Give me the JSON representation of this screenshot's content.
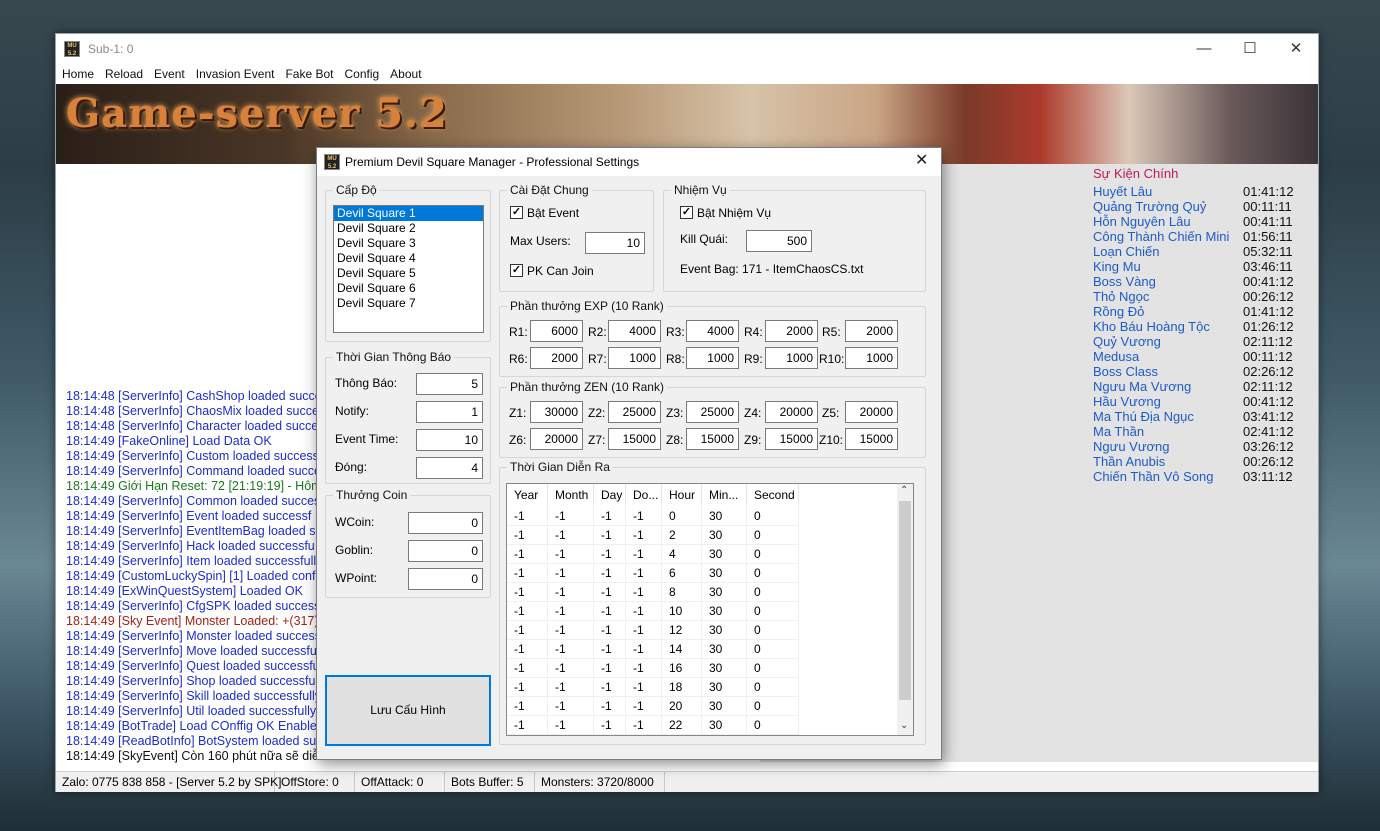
{
  "main": {
    "title": "Sub-1: 0",
    "icon": "mu-52-icon",
    "banner": "Game-server 5.2",
    "menu": [
      "Home",
      "Reload",
      "Event",
      "Invasion Event",
      "Fake Bot",
      "Config",
      "About"
    ]
  },
  "log": [
    {
      "t": "18:14:48 [ServerInfo] CashShop loaded succes",
      "c": "blue"
    },
    {
      "t": "18:14:48 [ServerInfo] ChaosMix loaded succe",
      "c": "blue"
    },
    {
      "t": "18:14:48 [ServerInfo] Character loaded succe",
      "c": "blue"
    },
    {
      "t": "18:14:49 [FakeOnline] Load Data OK",
      "c": "blue"
    },
    {
      "t": "18:14:49 [ServerInfo] Custom loaded success",
      "c": "blue"
    },
    {
      "t": "18:14:49 [ServerInfo] Command loaded succe",
      "c": "blue"
    },
    {
      "t": "18:14:49 Giới Hạn Reset: 72 [21:19:19] - Hôm",
      "c": "green"
    },
    {
      "t": "18:14:49 [ServerInfo] Common loaded succes",
      "c": "blue"
    },
    {
      "t": "18:14:49 [ServerInfo] Event loaded successf",
      "c": "blue"
    },
    {
      "t": "18:14:49 [ServerInfo] EventItemBag loaded s",
      "c": "blue"
    },
    {
      "t": "18:14:49 [ServerInfo] Hack loaded successfu",
      "c": "blue"
    },
    {
      "t": "18:14:49 [ServerInfo] Item loaded successfull",
      "c": "blue"
    },
    {
      "t": "18:14:49 [CustomLuckySpin] [1] Loaded conf",
      "c": "blue"
    },
    {
      "t": "18:14:49 [ExWinQuestSystem] Loaded OK",
      "c": "blue"
    },
    {
      "t": "18:14:49 [ServerInfo] CfgSPK loaded success",
      "c": "blue"
    },
    {
      "t": "18:14:49 [Sky Event] Monster Loaded: +(317)",
      "c": "red"
    },
    {
      "t": "18:14:49 [ServerInfo] Monster loaded success",
      "c": "blue"
    },
    {
      "t": "18:14:49 [ServerInfo] Move loaded successfu",
      "c": "blue"
    },
    {
      "t": "18:14:49 [ServerInfo] Quest loaded successfu",
      "c": "blue"
    },
    {
      "t": "18:14:49 [ServerInfo] Shop loaded successfu",
      "c": "blue"
    },
    {
      "t": "18:14:49 [ServerInfo] Skill loaded successfully",
      "c": "blue"
    },
    {
      "t": "18:14:49 [ServerInfo] Util loaded successfully",
      "c": "blue"
    },
    {
      "t": "18:14:49 [BotTrade] Load COnffig OK Enable",
      "c": "blue"
    },
    {
      "t": "18:14:49 [ReadBotInfo] BotSystem loaded su",
      "c": "blue"
    },
    {
      "t": "18:14:49 [SkyEvent] Còn 160 phút nữa sẽ diễ",
      "c": "black"
    }
  ],
  "events": {
    "title": "Sự Kiện Chính",
    "items": [
      {
        "n": "Huyết Lâu",
        "t": "01:41:12"
      },
      {
        "n": "Quảng Trường Quỷ",
        "t": "00:11:11"
      },
      {
        "n": "Hỗn Nguyên Lâu",
        "t": "00:41:11"
      },
      {
        "n": "Công Thành Chiến Mini",
        "t": "01:56:11"
      },
      {
        "n": "Loạn Chiến",
        "t": "05:32:11"
      },
      {
        "n": "King Mu",
        "t": "03:46:11"
      },
      {
        "n": "Boss Vàng",
        "t": "00:41:12"
      },
      {
        "n": "Thỏ Ngọc",
        "t": "00:26:12"
      },
      {
        "n": "Rồng Đỏ",
        "t": "01:41:12"
      },
      {
        "n": "Kho Báu Hoàng Tộc",
        "t": "01:26:12"
      },
      {
        "n": "Quỷ Vương",
        "t": "02:11:12"
      },
      {
        "n": "Medusa",
        "t": "00:11:12"
      },
      {
        "n": "Boss Class",
        "t": "02:26:12"
      },
      {
        "n": "Ngưu Ma Vương",
        "t": "02:11:12"
      },
      {
        "n": "Hầu Vương",
        "t": "00:41:12"
      },
      {
        "n": "Ma Thú Địa Ngục",
        "t": "03:41:12"
      },
      {
        "n": "Ma Thần",
        "t": "02:41:12"
      },
      {
        "n": "Ngưu Vương",
        "t": "03:26:12"
      },
      {
        "n": "Thần Anubis",
        "t": "00:26:12"
      },
      {
        "n": "Chiến Thần Vô Song",
        "t": "03:11:12"
      }
    ]
  },
  "status": [
    "Zalo: 0775 838 858 - [Server 5.2 by SPK]",
    "OffStore: 0",
    "OffAttack: 0",
    "Bots Buffer: 5",
    "Monsters: 3720/8000"
  ],
  "dialog": {
    "title": "Premium Devil Square Manager - Professional Settings",
    "level": {
      "legend": "Cấp Độ",
      "items": [
        "Devil Square 1",
        "Devil Square 2",
        "Devil Square 3",
        "Devil Square 4",
        "Devil Square 5",
        "Devil Square 6",
        "Devil Square 7"
      ],
      "selected": 0
    },
    "general": {
      "legend": "Cài Đặt Chung",
      "enable_label": "Bật Event",
      "enabled": true,
      "max_users_label": "Max Users:",
      "max_users": "10",
      "pk_label": "PK Can Join",
      "pk": true
    },
    "quest": {
      "legend": "Nhiệm Vụ",
      "enable_label": "Bật Nhiệm Vụ",
      "enabled": true,
      "kill_label": "Kill Quái:",
      "kill": "500",
      "bag": "Event Bag: 171 - ItemChaosCS.txt"
    },
    "exp": {
      "legend": "Phần thưởng EXP (10 Rank)",
      "labels": [
        "R1:",
        "R2:",
        "R3:",
        "R4:",
        "R5:",
        "R6:",
        "R7:",
        "R8:",
        "R9:",
        "R10:"
      ],
      "values": [
        "6000",
        "4000",
        "4000",
        "2000",
        "2000",
        "2000",
        "1000",
        "1000",
        "1000",
        "1000"
      ]
    },
    "zen": {
      "legend": "Phần thưởng ZEN (10 Rank)",
      "labels": [
        "Z1:",
        "Z2:",
        "Z3:",
        "Z4:",
        "Z5:",
        "Z6:",
        "Z7:",
        "Z8:",
        "Z9:",
        "Z10:"
      ],
      "values": [
        "30000",
        "25000",
        "25000",
        "20000",
        "20000",
        "20000",
        "15000",
        "15000",
        "15000",
        "15000"
      ]
    },
    "notice": {
      "legend": "Thời Gian Thông Báo",
      "labels": [
        "Thông Báo:",
        "Notify:",
        "Event Time:",
        "Đóng:"
      ],
      "values": [
        "5",
        "1",
        "10",
        "4"
      ]
    },
    "coin": {
      "legend": "Thưởng Coin",
      "labels": [
        "WCoin:",
        "Goblin:",
        "WPoint:"
      ],
      "values": [
        "0",
        "0",
        "0"
      ]
    },
    "schedule": {
      "legend": "Thời Gian Diễn Ra",
      "headers": [
        "Year",
        "Month",
        "Day",
        "Do...",
        "Hour",
        "Min...",
        "Second"
      ],
      "rows": [
        [
          "-1",
          "-1",
          "-1",
          "-1",
          "0",
          "30",
          "0"
        ],
        [
          "-1",
          "-1",
          "-1",
          "-1",
          "2",
          "30",
          "0"
        ],
        [
          "-1",
          "-1",
          "-1",
          "-1",
          "4",
          "30",
          "0"
        ],
        [
          "-1",
          "-1",
          "-1",
          "-1",
          "6",
          "30",
          "0"
        ],
        [
          "-1",
          "-1",
          "-1",
          "-1",
          "8",
          "30",
          "0"
        ],
        [
          "-1",
          "-1",
          "-1",
          "-1",
          "10",
          "30",
          "0"
        ],
        [
          "-1",
          "-1",
          "-1",
          "-1",
          "12",
          "30",
          "0"
        ],
        [
          "-1",
          "-1",
          "-1",
          "-1",
          "14",
          "30",
          "0"
        ],
        [
          "-1",
          "-1",
          "-1",
          "-1",
          "16",
          "30",
          "0"
        ],
        [
          "-1",
          "-1",
          "-1",
          "-1",
          "18",
          "30",
          "0"
        ],
        [
          "-1",
          "-1",
          "-1",
          "-1",
          "20",
          "30",
          "0"
        ],
        [
          "-1",
          "-1",
          "-1",
          "-1",
          "22",
          "30",
          "0"
        ]
      ]
    },
    "save_label": "Lưu Cấu Hình"
  }
}
